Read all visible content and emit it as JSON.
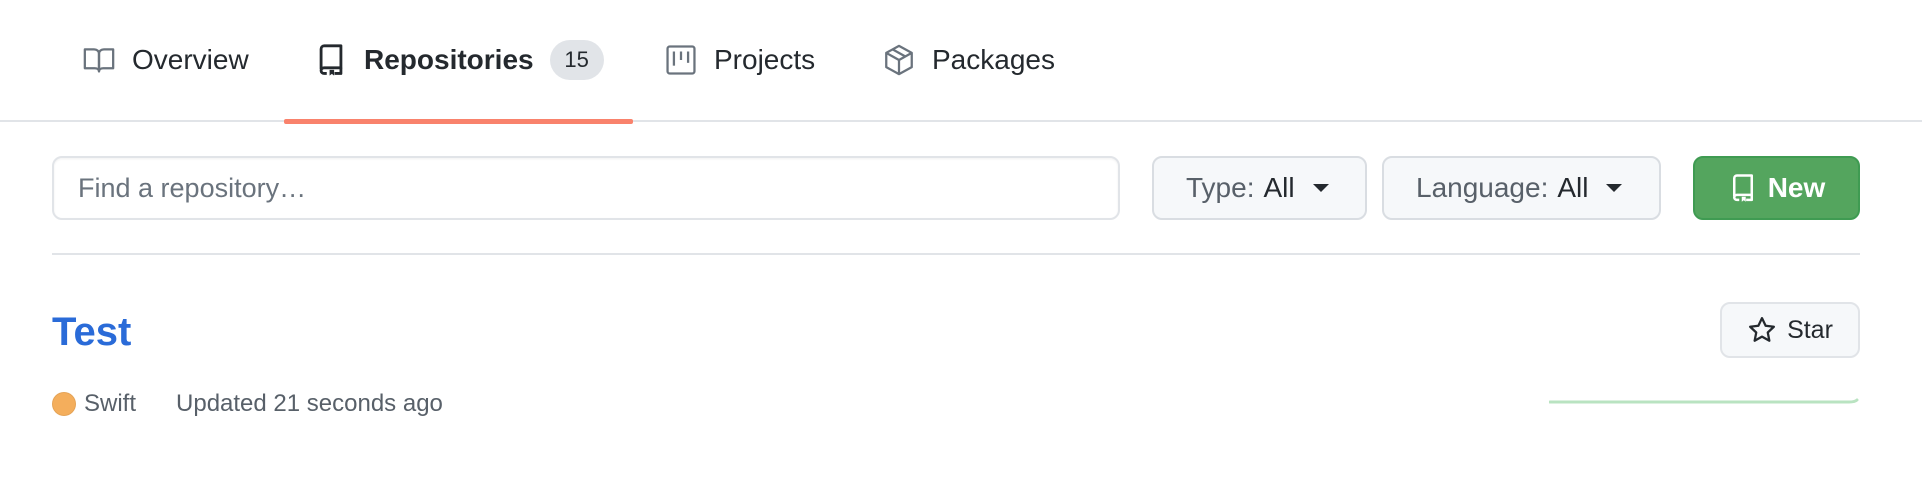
{
  "tabs": [
    {
      "label": "Overview",
      "icon": "book-icon",
      "active": false
    },
    {
      "label": "Repositories",
      "icon": "repo-icon",
      "active": true,
      "count": "15"
    },
    {
      "label": "Projects",
      "icon": "project-icon",
      "active": false
    },
    {
      "label": "Packages",
      "icon": "package-icon",
      "active": false
    }
  ],
  "filters": {
    "search_placeholder": "Find a repository…",
    "type_label": "Type:",
    "type_value": "All",
    "language_label": "Language:",
    "language_value": "All",
    "new_label": "New"
  },
  "repo": {
    "name": "Test",
    "language": "Swift",
    "language_color": "#f4ae5c",
    "updated": "Updated 21 seconds ago",
    "star_label": "Star"
  },
  "colors": {
    "active_tab_underline": "#f9826c",
    "new_button": "#54a55e",
    "link": "#2a6bd8",
    "activity_line": "#b9e3c1"
  }
}
